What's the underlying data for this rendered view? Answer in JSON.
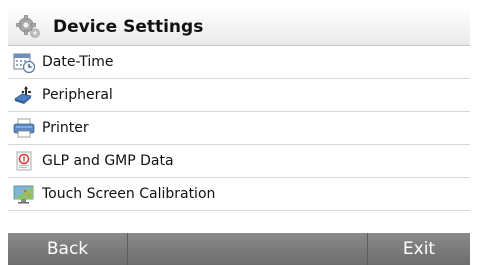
{
  "header": {
    "title": "Device Settings",
    "icon": "gear-icon"
  },
  "menu": {
    "items": [
      {
        "label": "Date-Time",
        "icon": "calendar-clock-icon"
      },
      {
        "label": "Peripheral",
        "icon": "usb-device-icon"
      },
      {
        "label": "Printer",
        "icon": "printer-icon"
      },
      {
        "label": "GLP and GMP Data",
        "icon": "report-icon"
      },
      {
        "label": "Touch Screen Calibration",
        "icon": "touchscreen-icon"
      }
    ]
  },
  "footer": {
    "back_label": "Back",
    "exit_label": "Exit"
  },
  "colors": {
    "footer_bg": "#7a7a7a",
    "header_bg": "#e9e9e9"
  }
}
